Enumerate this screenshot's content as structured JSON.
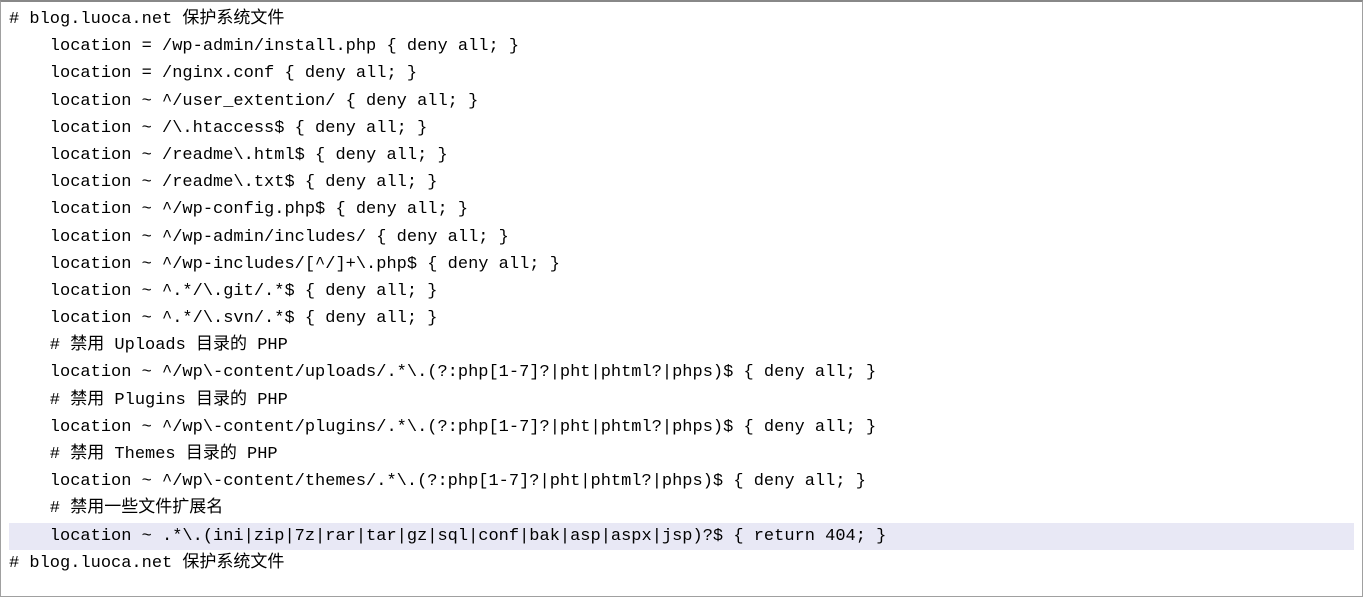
{
  "lines": [
    "# blog.luoca.net 保护系统文件",
    "    location = /wp-admin/install.php { deny all; }",
    "    location = /nginx.conf { deny all; }",
    "    location ~ ^/user_extention/ { deny all; }",
    "    location ~ /\\.htaccess$ { deny all; }",
    "    location ~ /readme\\.html$ { deny all; }",
    "    location ~ /readme\\.txt$ { deny all; }",
    "    location ~ ^/wp-config.php$ { deny all; }",
    "    location ~ ^/wp-admin/includes/ { deny all; }",
    "    location ~ ^/wp-includes/[^/]+\\.php$ { deny all; }",
    "    location ~ ^.*/\\.git/.*$ { deny all; }",
    "    location ~ ^.*/\\.svn/.*$ { deny all; }",
    "    # 禁用 Uploads 目录的 PHP",
    "    location ~ ^/wp\\-content/uploads/.*\\.(?:php[1-7]?|pht|phtml?|phps)$ { deny all; }",
    "    # 禁用 Plugins 目录的 PHP",
    "    location ~ ^/wp\\-content/plugins/.*\\.(?:php[1-7]?|pht|phtml?|phps)$ { deny all; }",
    "    # 禁用 Themes 目录的 PHP",
    "    location ~ ^/wp\\-content/themes/.*\\.(?:php[1-7]?|pht|phtml?|phps)$ { deny all; }",
    "    # 禁用一些文件扩展名",
    "    location ~ .*\\.(ini|zip|7z|rar|tar|gz|sql|conf|bak|asp|aspx|jsp)?$ { return 404; }",
    "# blog.luoca.net 保护系统文件"
  ],
  "highlighted_index": 19
}
